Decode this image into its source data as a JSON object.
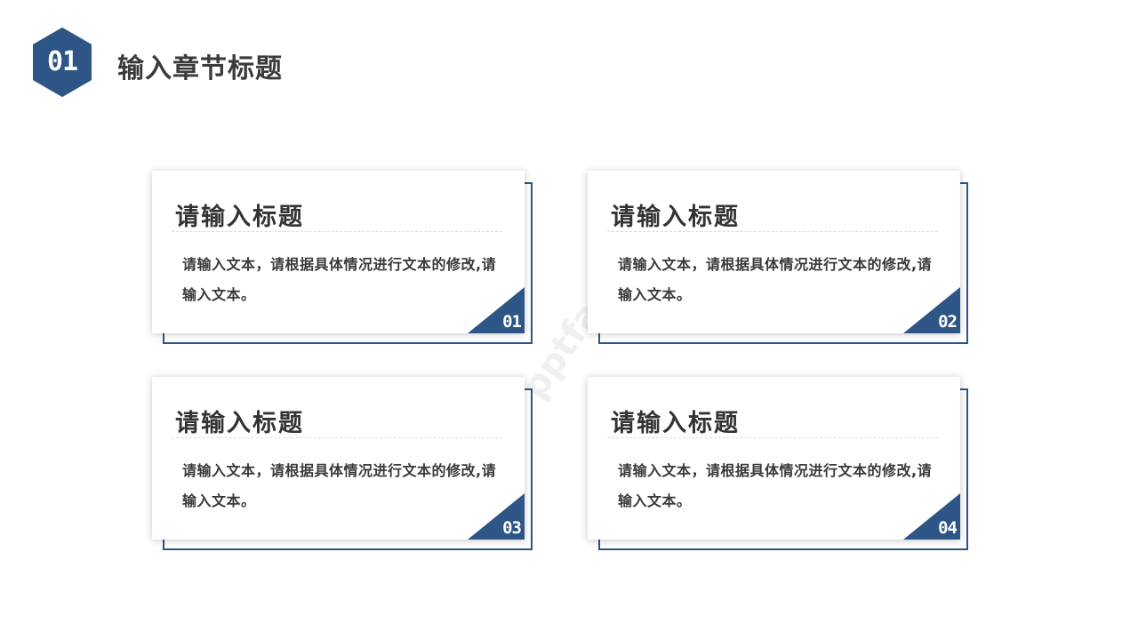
{
  "header": {
    "badge_number": "01",
    "title": "输入章节标题"
  },
  "colors": {
    "accent": "#2d5586",
    "title_text": "#333333",
    "body_text": "#3a3a3a"
  },
  "cards": [
    {
      "title": "请输入标题",
      "text": "请输入文本，请根据具体情况进行文本的修改,请输入文本。",
      "number": "01"
    },
    {
      "title": "请输入标题",
      "text": "请输入文本，请根据具体情况进行文本的修改,请输入文本。",
      "number": "02"
    },
    {
      "title": "请输入标题",
      "text": "请输入文本，请根据具体情况进行文本的修改,请输入文本。",
      "number": "03"
    },
    {
      "title": "请输入标题",
      "text": "请输入文本，请根据具体情况进行文本的修改,请输入文本。",
      "number": "04"
    }
  ]
}
